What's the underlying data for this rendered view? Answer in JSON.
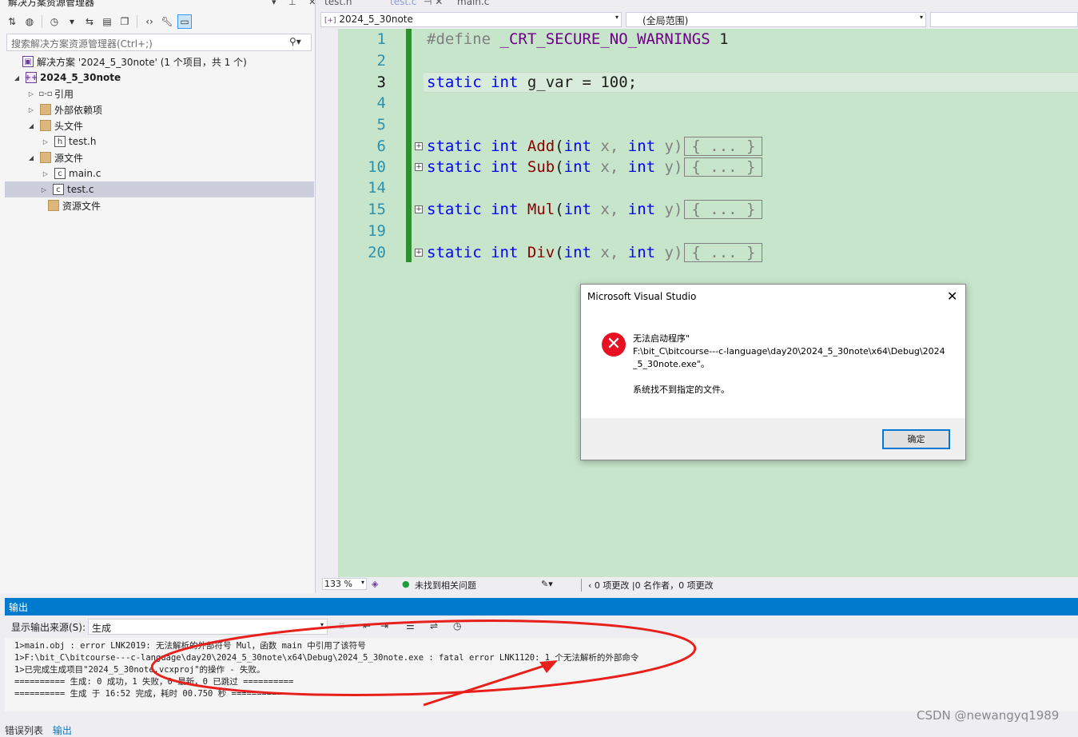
{
  "solution_explorer": {
    "title": "解决方案资源管理器",
    "title_controls": "▾ ⊥ ✕",
    "search_placeholder": "搜索解决方案资源管理器(Ctrl+;)",
    "tree": [
      {
        "label": "解决方案 '2024_5_30note' (1 个项目，共 1 个)",
        "icon": "solution-icon"
      },
      {
        "label": "2024_5_30note",
        "icon": "project-icon"
      },
      {
        "label": "引用",
        "icon": "references-icon"
      },
      {
        "label": "外部依赖项",
        "icon": "external-deps-icon"
      },
      {
        "label": "头文件",
        "icon": "folder-icon"
      },
      {
        "label": "test.h",
        "icon": "header-file-icon"
      },
      {
        "label": "源文件",
        "icon": "folder-icon"
      },
      {
        "label": "main.c",
        "icon": "c-file-icon"
      },
      {
        "label": "test.c",
        "icon": "c-file-icon"
      },
      {
        "label": "资源文件",
        "icon": "folder-icon"
      }
    ]
  },
  "editor": {
    "tabs": [
      "test.h",
      "test.c",
      "main.c"
    ],
    "tab_test_c_controls": "⊣ ✕",
    "nav_project": "2024_5_30note",
    "nav_scope": "(全局范围)",
    "lines": {
      "l1": "1",
      "l2": "2",
      "l3": "3",
      "l4": "4",
      "l5": "5",
      "l6": "6",
      "l10": "10",
      "l14": "14",
      "l15": "15",
      "l19": "19",
      "l20": "20"
    },
    "code": {
      "define_kw": "#define",
      "define_name": "_CRT_SECURE_NO_WARNINGS",
      "define_val": " 1",
      "static": "static",
      "int": "int",
      "gvar_rest": " g_var = 100;",
      "add": "Add",
      "sub": "Sub",
      "mul": "Mul",
      "div": "Div",
      "params_open": "(",
      "x": " x, ",
      "y": " y)",
      "collapsed": "{ ... }"
    },
    "status": {
      "zoom": "133 %",
      "issues": "未找到相关问题",
      "changes": "0 项更改 |0 名作者，0 项更改"
    }
  },
  "dialog": {
    "title": "Microsoft Visual Studio",
    "message_line1": "无法启动程序\"",
    "message_line2": "F:\\bit_C\\bitcourse---c-language\\day20\\2024_5_30note\\x64\\Debug\\2024",
    "message_line3": "_5_30note.exe\"。",
    "message_line4": "系统找不到指定的文件。",
    "ok": "确定"
  },
  "output": {
    "title": "输出",
    "source_label": "显示输出来源(S):",
    "source_value": "生成",
    "lines": [
      "1>main.obj : error LNK2019: 无法解析的外部符号 Mul，函数 main 中引用了该符号",
      "1>F:\\bit_C\\bitcourse---c-language\\day20\\2024_5_30note\\x64\\Debug\\2024_5_30note.exe : fatal error LNK1120: 1 个无法解析的外部命令",
      "1>已完成生成项目\"2024_5_30note.vcxproj\"的操作 - 失败。",
      "========== 生成: 0 成功，1 失败，0 最新，0 已跳过 ==========",
      "========== 生成 于 16:52 完成，耗时 00.750 秒 =========="
    ],
    "bottom_tabs": [
      "错误列表",
      "输出"
    ]
  },
  "watermark": "CSDN @newangyq1989",
  "colors": {
    "editor_bg": "#c7e5cb",
    "accent": "#007acc",
    "keyword": "#0000ff",
    "macro": "#6f008a",
    "annotation": "#e8201c"
  }
}
